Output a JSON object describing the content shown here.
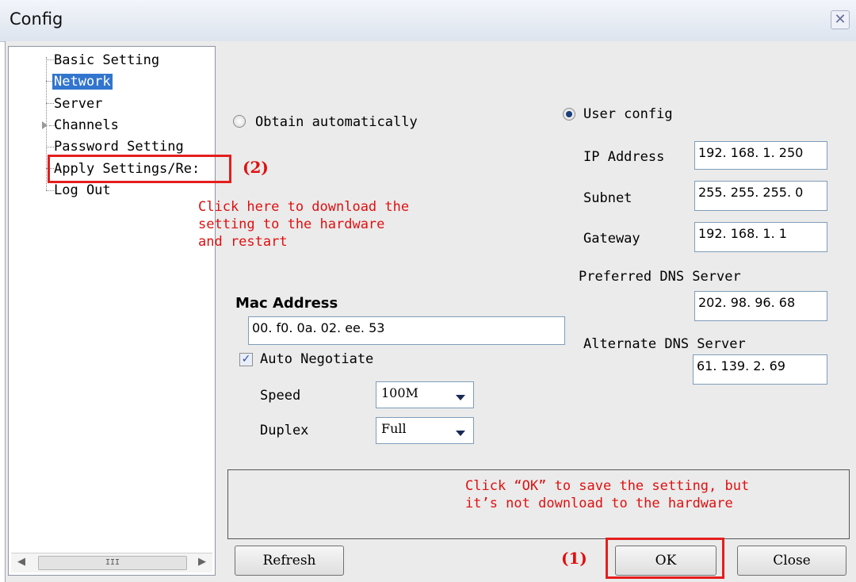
{
  "window": {
    "title": "Config",
    "close_icon": "close-icon"
  },
  "tree": {
    "items": [
      {
        "label": "Basic Setting"
      },
      {
        "label": "Network",
        "selected": true
      },
      {
        "label": "Server"
      },
      {
        "label": "Channels",
        "expandable": true
      },
      {
        "label": "Password Setting"
      },
      {
        "label": "Apply Settings/Re:"
      },
      {
        "label": "Log Out"
      }
    ],
    "scrollbar_thumb": "III"
  },
  "annotations": {
    "apply_marker": "(2)",
    "apply_note_line1": "Click here to download the",
    "apply_note_line2": "setting to the hardware",
    "apply_note_line3": "and restart",
    "ok_marker": "(1)",
    "ok_note_line1": "Click “OK” to save the setting, but",
    "ok_note_line2": "it’s not download to the hardware",
    "highlight_color": "#e51e1e"
  },
  "network": {
    "obtain_auto_label": "Obtain automatically",
    "user_config_label": "User config",
    "mode": "User config",
    "ip_label": "IP Address",
    "ip_value": "192. 168. 1. 250",
    "subnet_label": "Subnet",
    "subnet_value": "255. 255. 255. 0",
    "gateway_label": "Gateway",
    "gateway_value": "192. 168. 1. 1",
    "preferred_dns_label": "Preferred DNS Server",
    "preferred_dns_value": "202. 98. 96. 68",
    "alternate_dns_label": "Alternate DNS Server",
    "alternate_dns_value": "61. 139. 2. 69",
    "mac_label": "Mac Address",
    "mac_value": "00. f0. 0a. 02. ee. 53",
    "auto_negotiate_label": "Auto Negotiate",
    "auto_negotiate_checked": true,
    "speed_label": "Speed",
    "speed_value": "100M",
    "duplex_label": "Duplex",
    "duplex_value": "Full"
  },
  "buttons": {
    "refresh": "Refresh",
    "ok": "OK",
    "close": "Close"
  }
}
